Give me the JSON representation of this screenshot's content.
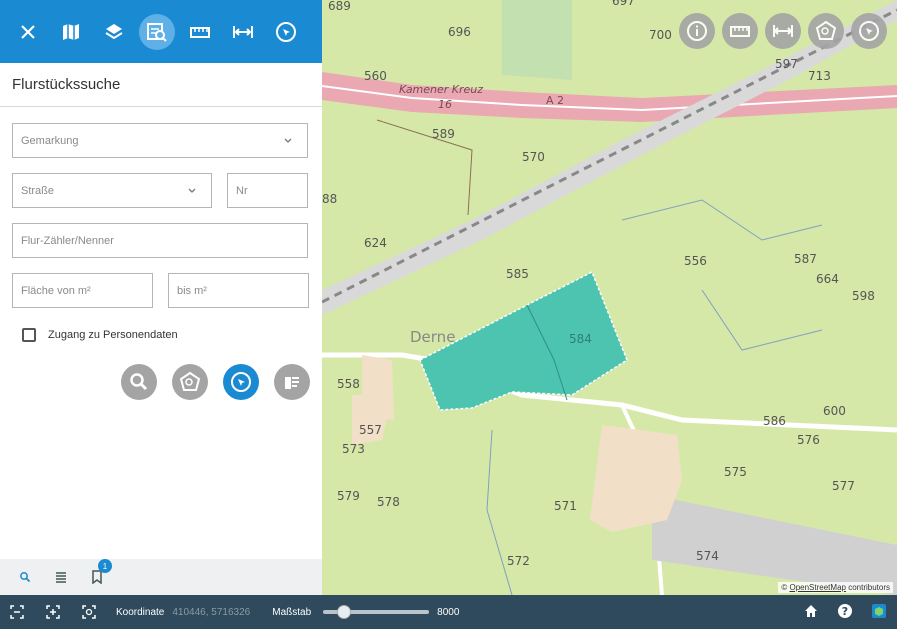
{
  "toolbar": {
    "close": "close-icon",
    "items": [
      "map-icon",
      "layers-icon",
      "parcel-search-icon",
      "measure-area-icon",
      "measure-distance-icon",
      "select-icon"
    ]
  },
  "panel": {
    "title": "Flurstückssuche",
    "gemarkung_placeholder": "Gemarkung",
    "strasse_placeholder": "Straße",
    "nr_placeholder": "Nr",
    "flur_placeholder": "Flur-Zähler/Nenner",
    "flaeche_von_placeholder": "Fläche von m²",
    "flaeche_bis_placeholder": "bis m²",
    "checkbox_label": "Zugang zu Personendaten"
  },
  "tabs": {
    "badge": "1"
  },
  "map": {
    "labels": {
      "l689": "689",
      "l696": "696",
      "l697": "697",
      "l700": "700",
      "l597": "597",
      "l713": "713",
      "l560": "560",
      "street_kreuz": "Kamener Kreuz",
      "street_16": "16",
      "street_a2": "A 2",
      "l589": "589",
      "l570": "570",
      "l88": "88",
      "l624": "624",
      "l585": "585",
      "l556": "556",
      "l587": "587",
      "l664": "664",
      "l598": "598",
      "l584": "584",
      "derne": "Derne",
      "l558": "558",
      "l557": "557",
      "l573": "573",
      "l579": "579",
      "l578": "578",
      "l586": "586",
      "l600": "600",
      "l576": "576",
      "l575": "575",
      "l577": "577",
      "l571": "571",
      "l572": "572",
      "l574": "574"
    },
    "attribution_prefix": "©",
    "attribution_link": "OpenStreetMap",
    "attribution_suffix": "contributors"
  },
  "statusbar": {
    "coord_label": "Koordinate",
    "coord_value": "410446, 5716326",
    "scale_label": "Maßstab",
    "scale_value": "8000",
    "scale_level": 0.15
  },
  "colors": {
    "accent": "#1a8ad2",
    "parcel": "#4cc4b0",
    "statusbar": "#2e4a5c"
  }
}
